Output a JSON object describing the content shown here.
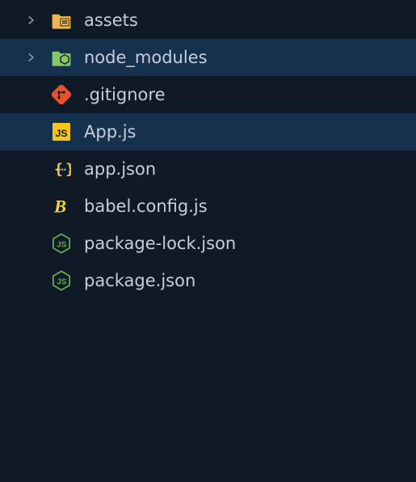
{
  "explorer": {
    "items": [
      {
        "type": "folder",
        "name": "assets",
        "expanded": false,
        "highlighted": false,
        "icon": "folder-assets-icon"
      },
      {
        "type": "folder",
        "name": "node_modules",
        "expanded": false,
        "highlighted": true,
        "icon": "folder-node-icon"
      },
      {
        "type": "file",
        "name": ".gitignore",
        "highlighted": false,
        "icon": "git-icon"
      },
      {
        "type": "file",
        "name": "App.js",
        "highlighted": true,
        "icon": "js-icon"
      },
      {
        "type": "file",
        "name": "app.json",
        "highlighted": false,
        "icon": "json-icon"
      },
      {
        "type": "file",
        "name": "babel.config.js",
        "highlighted": false,
        "icon": "babel-icon"
      },
      {
        "type": "file",
        "name": "package-lock.json",
        "highlighted": false,
        "icon": "nodejs-icon"
      },
      {
        "type": "file",
        "name": "package.json",
        "highlighted": false,
        "icon": "nodejs-icon"
      }
    ]
  },
  "colors": {
    "bg": "#0f1a26",
    "highlight": "#15314d",
    "text": "#c7ced9",
    "chevron": "#9aa5b8",
    "folderAssets": "#efb64e",
    "folderNode": "#88c66b",
    "git": "#e8502b",
    "jsBg": "#f5c518",
    "jsFg": "#1a1a1a",
    "jsonBrace": "#f2c94c",
    "jsonDots": "#b2b9c7",
    "babel": "#f5d43c",
    "nodeHex": "#6aa84f",
    "nodeText": "#6aa84f"
  }
}
